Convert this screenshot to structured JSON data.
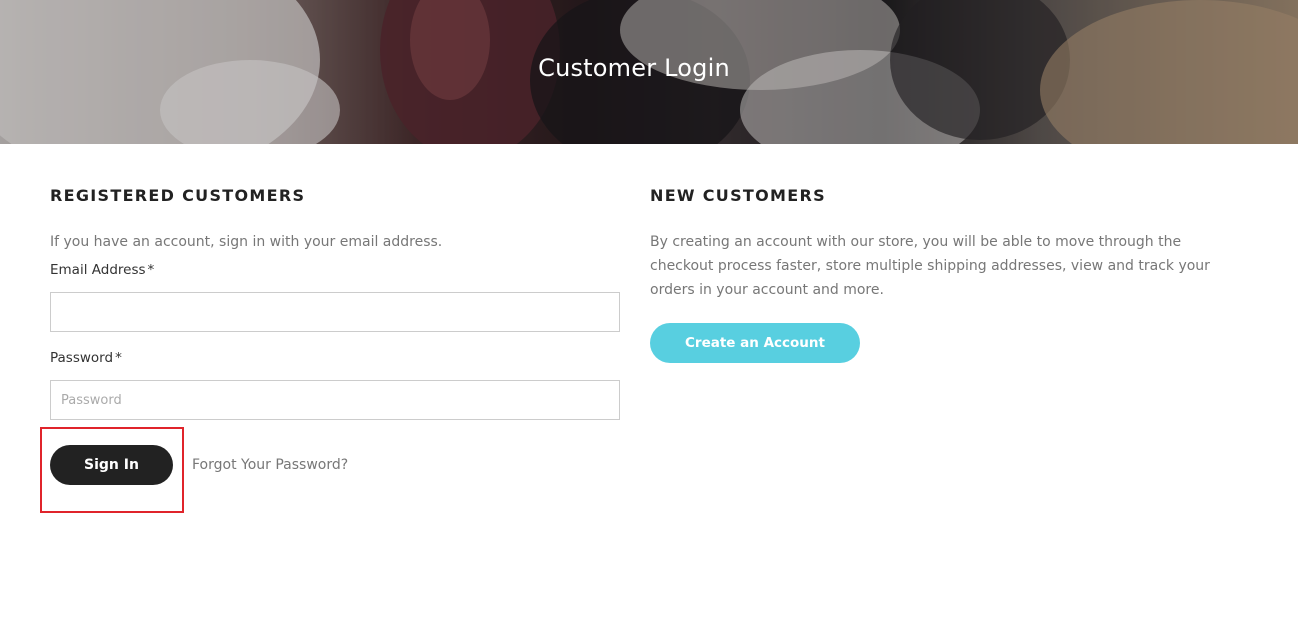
{
  "hero": {
    "title": "Customer Login"
  },
  "registered": {
    "heading": "REGISTERED CUSTOMERS",
    "intro": "If you have an account, sign in with your email address.",
    "email_label": "Email Address",
    "email_required_mark": "*",
    "email_value": "",
    "email_placeholder": "",
    "password_label": "Password",
    "password_required_mark": "*",
    "password_value": "",
    "password_placeholder": "Password",
    "signin_label": "Sign In",
    "forgot_label": "Forgot Your Password?"
  },
  "new_customers": {
    "heading": "NEW CUSTOMERS",
    "intro": "By creating an account with our store, you will be able to move through the checkout process faster, store multiple shipping addresses, view and track your orders in your account and more.",
    "create_label": "Create an Account"
  },
  "colors": {
    "primary_button": "#222222",
    "accent_button": "#58cfe0",
    "highlight": "#e0242b"
  }
}
